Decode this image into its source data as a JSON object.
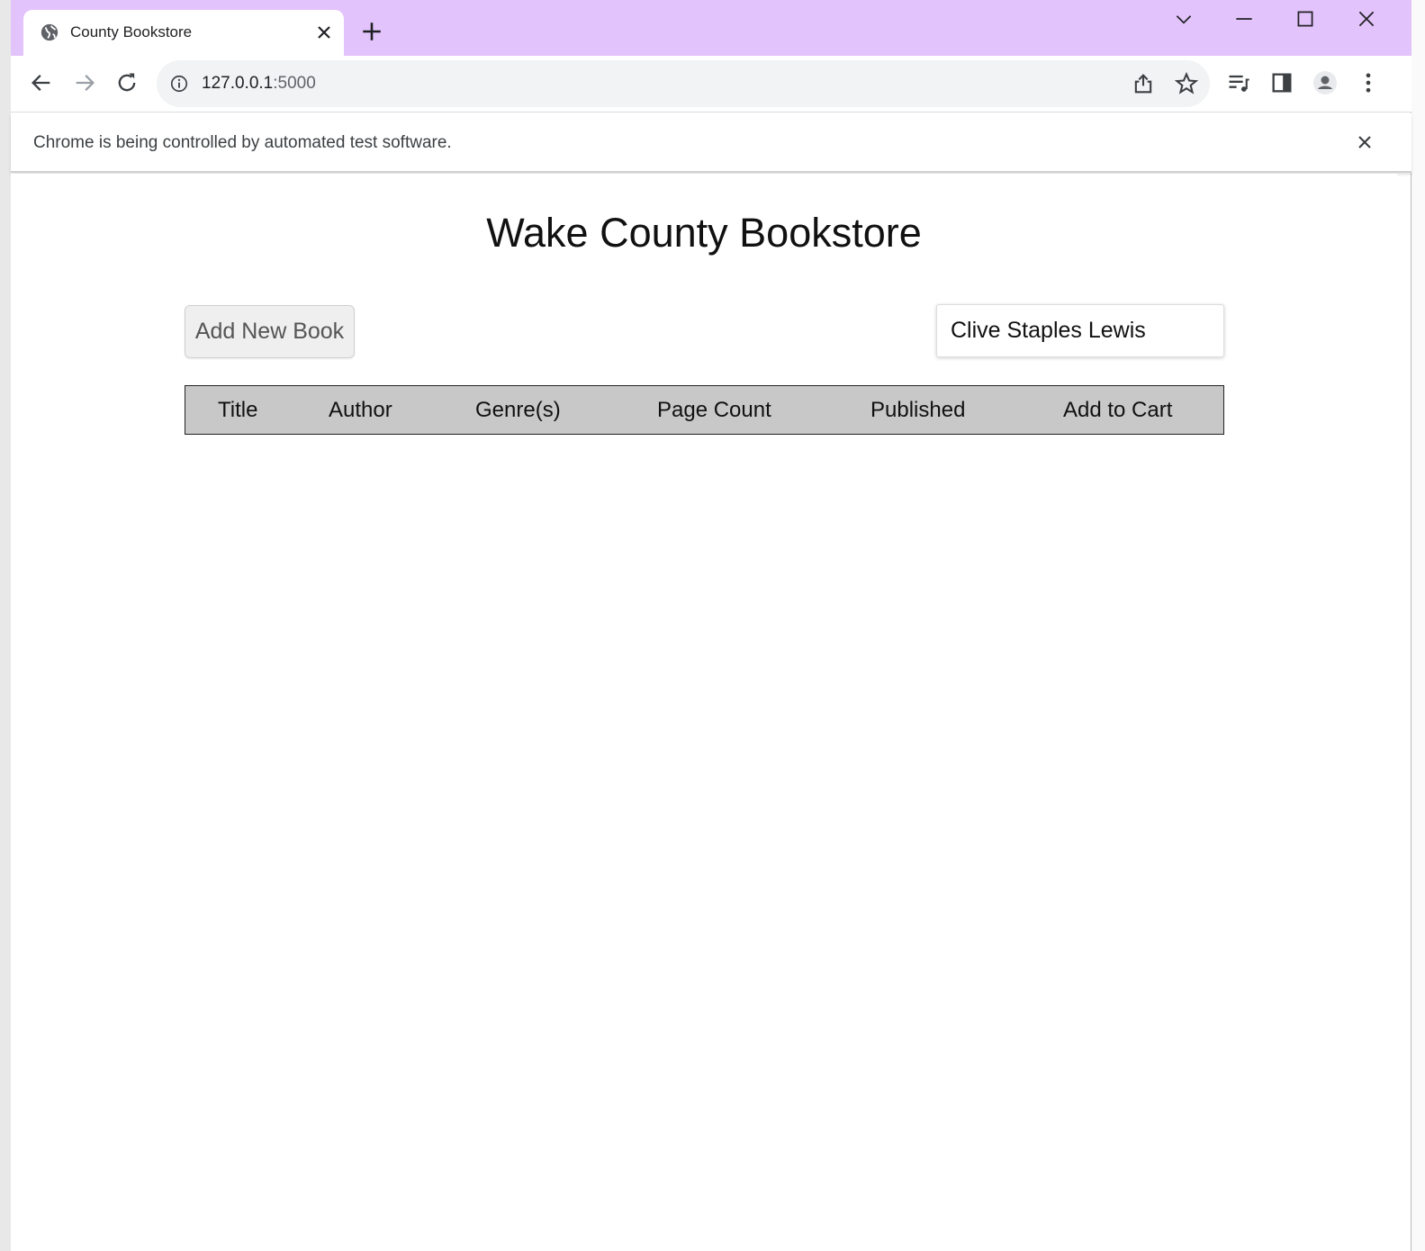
{
  "browser": {
    "tab": {
      "title": "County Bookstore"
    },
    "address": {
      "host": "127.0.0.1",
      "port": ":5000"
    },
    "infobar": {
      "message": "Chrome is being controlled by automated test software."
    }
  },
  "page": {
    "title": "Wake County Bookstore",
    "add_button": "Add New Book",
    "search": {
      "value": "Clive Staples Lewis"
    },
    "table": {
      "headers": [
        "Title",
        "Author",
        "Genre(s)",
        "Page Count",
        "Published",
        "Add to Cart"
      ]
    }
  },
  "icons": {
    "tab": "globe-icon",
    "toolbar": [
      "back-arrow-icon",
      "forward-arrow-icon",
      "reload-icon",
      "info-icon",
      "share-icon",
      "star-icon",
      "media-icon",
      "side-panel-icon",
      "profile-icon",
      "kebab-menu-icon"
    ],
    "window": [
      "chevron-down-icon",
      "minimize-icon",
      "maximize-icon",
      "close-icon"
    ]
  }
}
